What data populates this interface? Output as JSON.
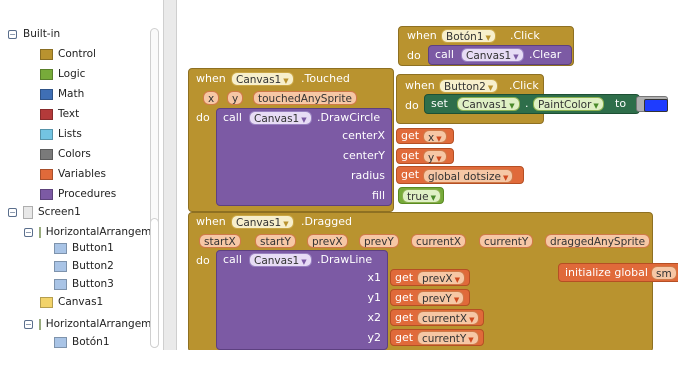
{
  "sidebar": {
    "builtin_label": "Built-in",
    "categories": [
      {
        "label": "Control",
        "color": "#b9932f"
      },
      {
        "label": "Logic",
        "color": "#77ab3a"
      },
      {
        "label": "Math",
        "color": "#3f6fb5"
      },
      {
        "label": "Text",
        "color": "#b43a3a"
      },
      {
        "label": "Lists",
        "color": "#73c4e2"
      },
      {
        "label": "Colors",
        "color": "#7a7a7a"
      },
      {
        "label": "Variables",
        "color": "#e06a3a"
      },
      {
        "label": "Procedures",
        "color": "#7c5aa4"
      }
    ],
    "screen_label": "Screen1",
    "components": [
      {
        "label": "HorizontalArrangemen",
        "icon": "arrangement-icon"
      },
      {
        "label": "Button1",
        "icon": "button-icon"
      },
      {
        "label": "Button2",
        "icon": "button-icon"
      },
      {
        "label": "Button3",
        "icon": "button-icon"
      },
      {
        "label": "Canvas1",
        "icon": "canvas-icon"
      },
      {
        "label": "HorizontalArrangemen",
        "icon": "arrangement-icon"
      },
      {
        "label": "Botón1",
        "icon": "button-icon"
      }
    ]
  },
  "blocks": {
    "b1": {
      "when": "when",
      "component": "Botón1",
      "event": ".Click",
      "do": "do",
      "call": "call",
      "target": "Canvas1",
      "method": ".Clear"
    },
    "b2": {
      "when": "when",
      "component": "Button2",
      "event": ".Click",
      "do": "do",
      "set": "set",
      "target": "Canvas1",
      "dot": ".",
      "property": "PaintColor",
      "to": "to",
      "color": "#1e3cff"
    },
    "b3": {
      "when": "when",
      "component": "Canvas1",
      "event": ".Touched",
      "params": [
        "x",
        "y",
        "touchedAnySprite"
      ],
      "do": "do",
      "call": "call",
      "target": "Canvas1",
      "method": ".DrawCircle",
      "args": [
        {
          "name": "centerX",
          "get": "get",
          "value": "x"
        },
        {
          "name": "centerY",
          "get": "get",
          "value": "y"
        },
        {
          "name": "radius",
          "get": "get",
          "value": "global dotsize"
        },
        {
          "name": "fill",
          "value": "true"
        }
      ]
    },
    "b4": {
      "when": "when",
      "component": "Canvas1",
      "event": ".Dragged",
      "params": [
        "startX",
        "startY",
        "prevX",
        "prevY",
        "currentX",
        "currentY",
        "draggedAnySprite"
      ],
      "do": "do",
      "call": "call",
      "target": "Canvas1",
      "method": ".DrawLine",
      "args": [
        {
          "name": "x1",
          "get": "get",
          "value": "prevX"
        },
        {
          "name": "y1",
          "get": "get",
          "value": "prevY"
        },
        {
          "name": "x2",
          "get": "get",
          "value": "currentX"
        },
        {
          "name": "y2",
          "get": "get",
          "value": "currentY"
        }
      ]
    },
    "b5": {
      "label": "initialize global",
      "name": "sm"
    }
  }
}
